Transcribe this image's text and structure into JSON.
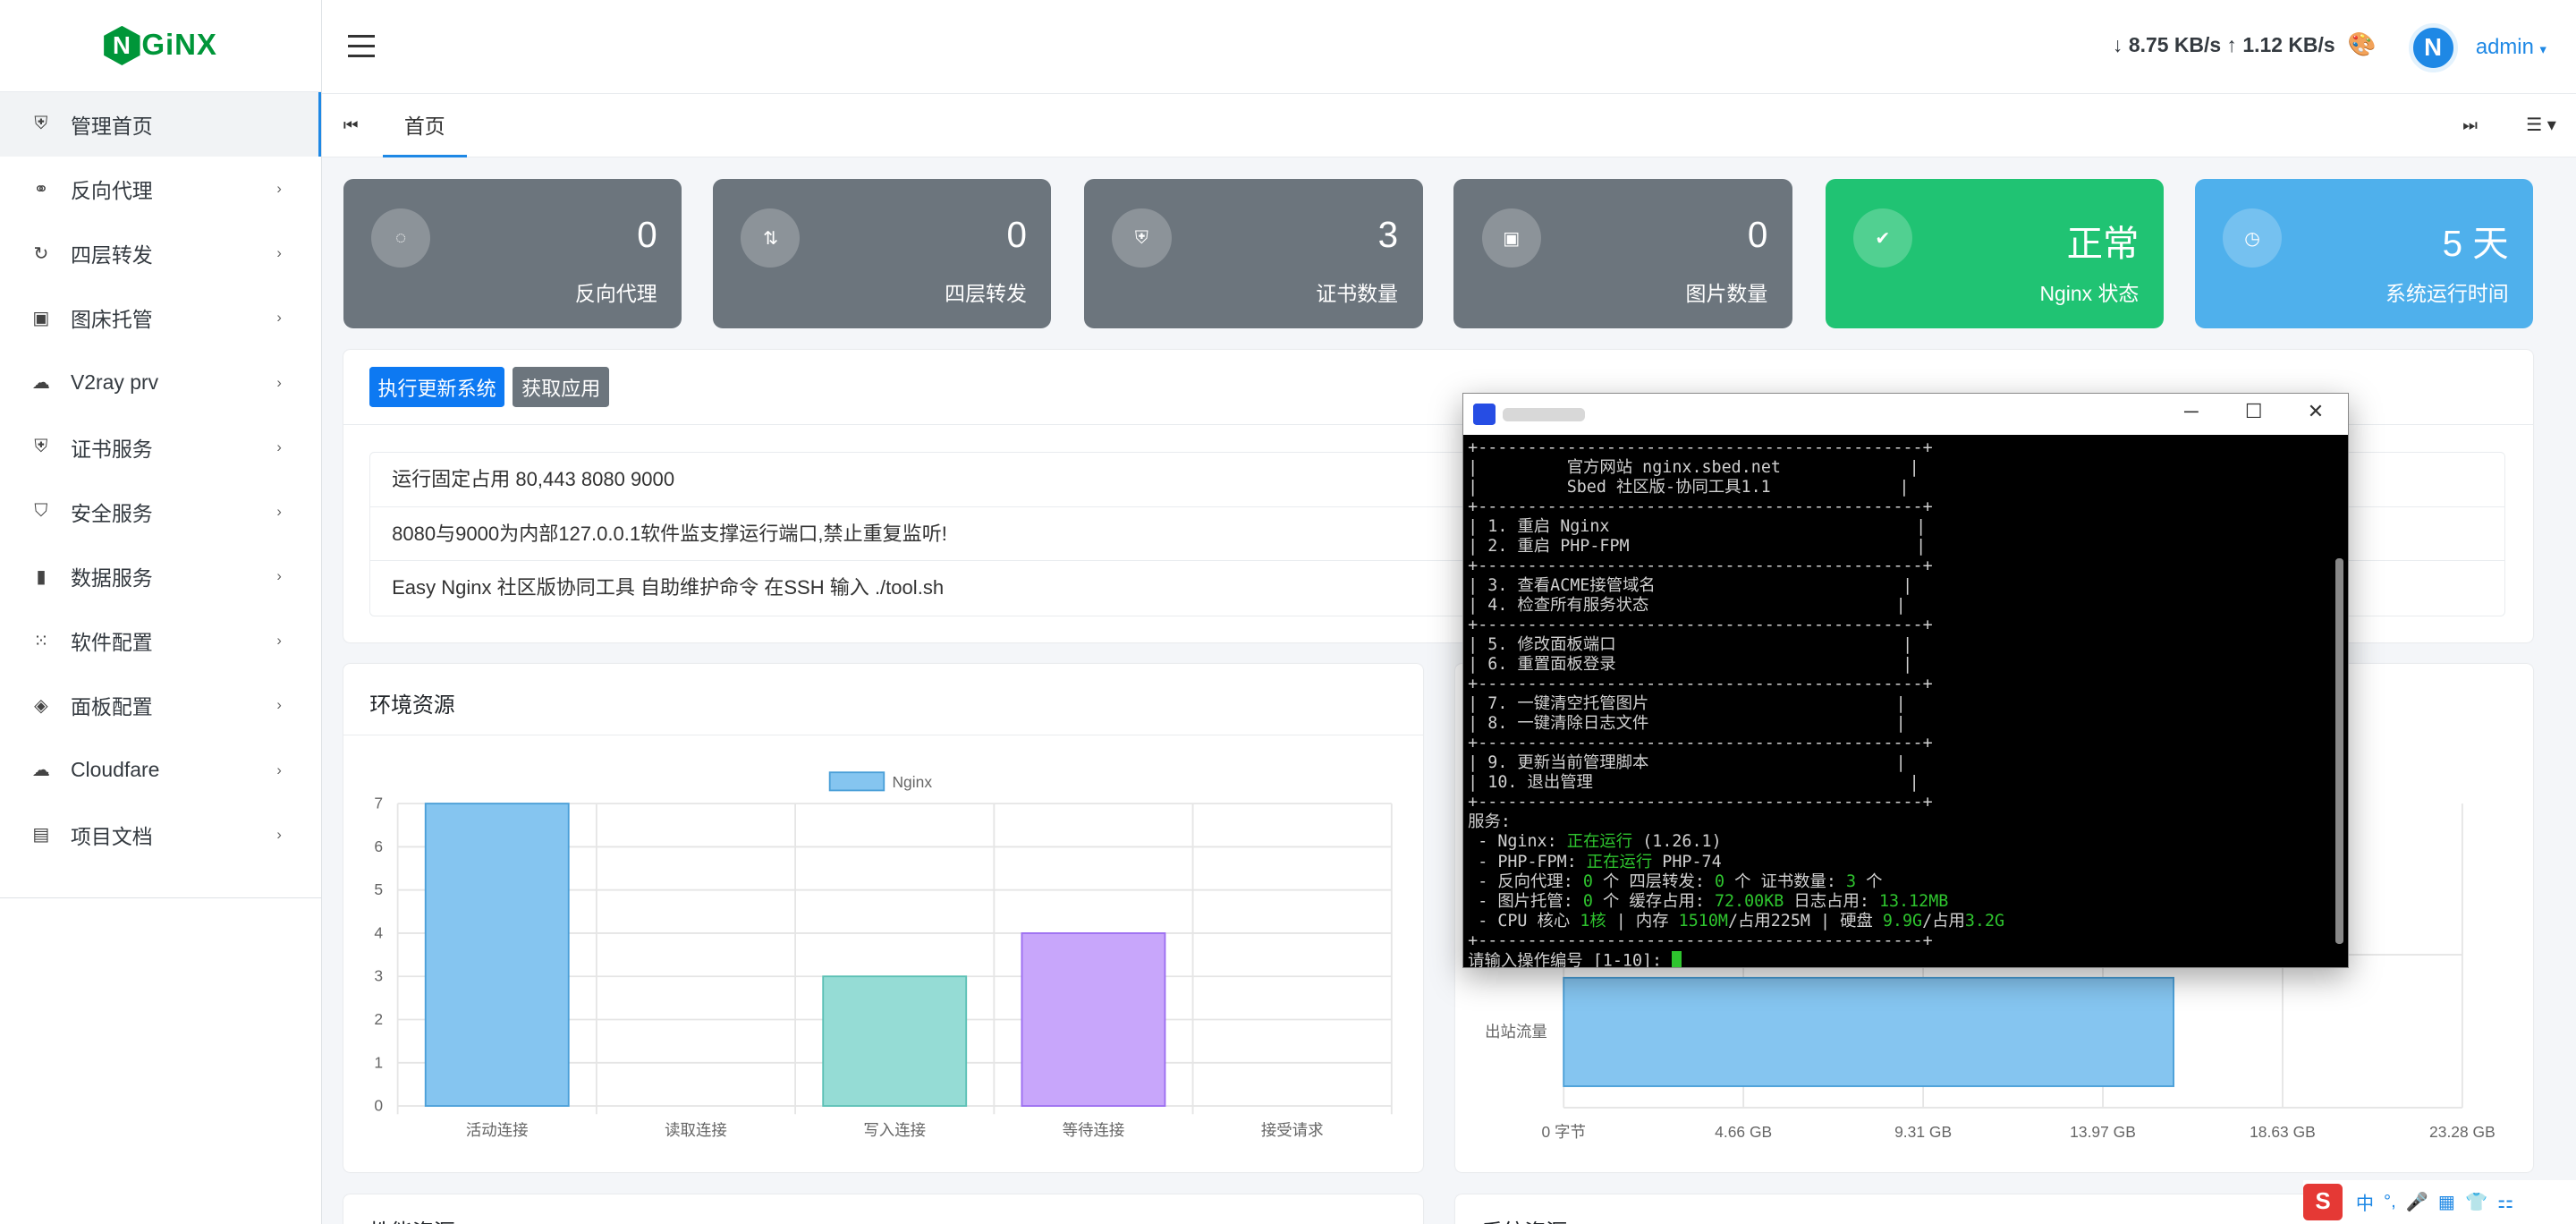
{
  "brand": {
    "logo_text": "NGiNX",
    "color": "#009639"
  },
  "sidebar": {
    "items": [
      {
        "label": "管理首页",
        "icon": "shield-icon",
        "active": true,
        "has_submenu": false
      },
      {
        "label": "反向代理",
        "icon": "link-icon",
        "active": false,
        "has_submenu": true
      },
      {
        "label": "四层转发",
        "icon": "refresh-icon",
        "active": false,
        "has_submenu": true
      },
      {
        "label": "图床托管",
        "icon": "image-icon",
        "active": false,
        "has_submenu": true
      },
      {
        "label": "V2ray prv",
        "icon": "cloud-icon",
        "active": false,
        "has_submenu": true
      },
      {
        "label": "证书服务",
        "icon": "certificate-icon",
        "active": false,
        "has_submenu": true
      },
      {
        "label": "安全服务",
        "icon": "security-shield-icon",
        "active": false,
        "has_submenu": true
      },
      {
        "label": "数据服务",
        "icon": "bar-chart-icon",
        "active": false,
        "has_submenu": true
      },
      {
        "label": "软件配置",
        "icon": "grid-icon",
        "active": false,
        "has_submenu": true
      },
      {
        "label": "面板配置",
        "icon": "cube-icon",
        "active": false,
        "has_submenu": true
      },
      {
        "label": "Cloudfare",
        "icon": "cloud-icon",
        "active": false,
        "has_submenu": true
      },
      {
        "label": "项目文档",
        "icon": "document-icon",
        "active": false,
        "has_submenu": true
      }
    ]
  },
  "header": {
    "net_speed": "↓ 8.75 KB/s ↑ 1.12 KB/s",
    "username": "admin",
    "avatar_letter": "N"
  },
  "tabs": {
    "home": "首页"
  },
  "stats": [
    {
      "value": "0",
      "label": "反向代理",
      "icon": "loader-icon",
      "color": "#6c757d"
    },
    {
      "value": "0",
      "label": "四层转发",
      "icon": "transfer-icon",
      "color": "#6c757d"
    },
    {
      "value": "3",
      "label": "证书数量",
      "icon": "shield-icon",
      "color": "#6c757d"
    },
    {
      "value": "0",
      "label": "图片数量",
      "icon": "images-icon",
      "color": "#6c757d"
    },
    {
      "value": "正常",
      "label": "Nginx 状态",
      "icon": "check-circle-icon",
      "color": "#20c373"
    },
    {
      "value": "5 天",
      "label": "系统运行时间",
      "icon": "clock-icon",
      "color": "#4fb0ec"
    }
  ],
  "notice": {
    "update_button": "执行更新系统",
    "fetch_button": "获取应用",
    "lines": [
      "运行固定占用 80,443 8080 9000",
      "8080与9000为内部127.0.0.1软件监支撑运行端口,禁止重复监听!",
      "Easy Nginx 社区版协同工具 自助维护命令 在SSH 输入 ./tool.sh"
    ]
  },
  "env_card": {
    "title": "环境资源"
  },
  "bottom_cards": {
    "left_title": "性能资源",
    "right_title": "系统资源"
  },
  "chart_data": [
    {
      "type": "bar",
      "legend": [
        "Nginx"
      ],
      "legend_position": "top",
      "categories": [
        "活动连接",
        "读取连接",
        "写入连接",
        "等待连接",
        "接受请求"
      ],
      "values": [
        7,
        0,
        3,
        4,
        0
      ],
      "colors": [
        "#85c5f0",
        "#85c5f0",
        "#95dcd5",
        "#c8a6fb",
        "#85c5f0"
      ],
      "ylim": [
        0,
        7
      ],
      "yticks": [
        "0",
        "1",
        "2",
        "3",
        "4",
        "5",
        "6",
        "7"
      ],
      "grid": true
    },
    {
      "type": "bar",
      "orientation": "horizontal",
      "categories": [
        "出站流量"
      ],
      "values": [
        15.8
      ],
      "unit": "GB",
      "xlim": [
        0,
        23.28
      ],
      "xticks": [
        "0 字节",
        "4.66 GB",
        "9.31 GB",
        "13.97 GB",
        "18.63 GB",
        "23.28 GB"
      ],
      "colors": [
        "#85c5f0"
      ],
      "grid": true
    }
  ],
  "terminal": {
    "lines": [
      {
        "t": "+---------------------------------------------+"
      },
      {
        "t": "|         官方网站 nginx.sbed.net             |"
      },
      {
        "t": "|         Sbed 社区版-协同工具1.1             |"
      },
      {
        "t": "+---------------------------------------------+"
      },
      {
        "t": "| 1. 重启 Nginx                               |"
      },
      {
        "t": "| 2. 重启 PHP-FPM                             |"
      },
      {
        "t": "+---------------------------------------------+"
      },
      {
        "t": "| 3. 查看ACME接管域名                         |"
      },
      {
        "t": "| 4. 检查所有服务状态                         |"
      },
      {
        "t": "+---------------------------------------------+"
      },
      {
        "t": "| 5. 修改面板端口                             |"
      },
      {
        "t": "| 6. 重置面板登录                             |"
      },
      {
        "t": "+---------------------------------------------+"
      },
      {
        "t": "| 7. 一键清空托管图片                         |"
      },
      {
        "t": "| 8. 一键清除日志文件                         |"
      },
      {
        "t": "+---------------------------------------------+"
      },
      {
        "t": "| 9. 更新当前管理脚本                         |"
      },
      {
        "t": "| 10. 退出管理                                |"
      },
      {
        "t": "+---------------------------------------------+"
      },
      {
        "t": "服务:"
      }
    ],
    "svc": {
      "nginx_pre": " - Nginx: ",
      "nginx_status": "正在运行",
      "nginx_ver": " (1.26.1)",
      "php_pre": " - PHP-FPM: ",
      "php_status": "正在运行",
      "php_ver": " PHP-74",
      "rp_pre": " - 反向代理: ",
      "rp_val": "0",
      "l4_pre": " 个 四层转发: ",
      "l4_val": "0",
      "cert_pre": " 个 证书数量: ",
      "cert_val": "3",
      "cert_post": " 个",
      "img_pre": " - 图片托管: ",
      "img_val": "0",
      "cache_pre": " 个 缓存占用: ",
      "cache_val": "72.00KB",
      "log_pre": " 日志占用: ",
      "log_val": "13.12MB",
      "cpu_pre": " - CPU 核心 ",
      "cpu_val": "1核",
      "mem_pre": " | 内存 ",
      "mem_val": "1510M",
      "mem_mid": "/占用225M | 硬盘 ",
      "disk_val": "9.9G",
      "disk_mid": "/占用",
      "disk_used": "3.2G"
    },
    "sep_end": "+---------------------------------------------+",
    "prompt": "请输入操作编号 [1-10]: "
  },
  "tray": {
    "ime": "中",
    "items": [
      "°,",
      "🎤",
      "▦",
      "👕",
      "⚏",
      "⚙"
    ],
    "logo": "S"
  }
}
